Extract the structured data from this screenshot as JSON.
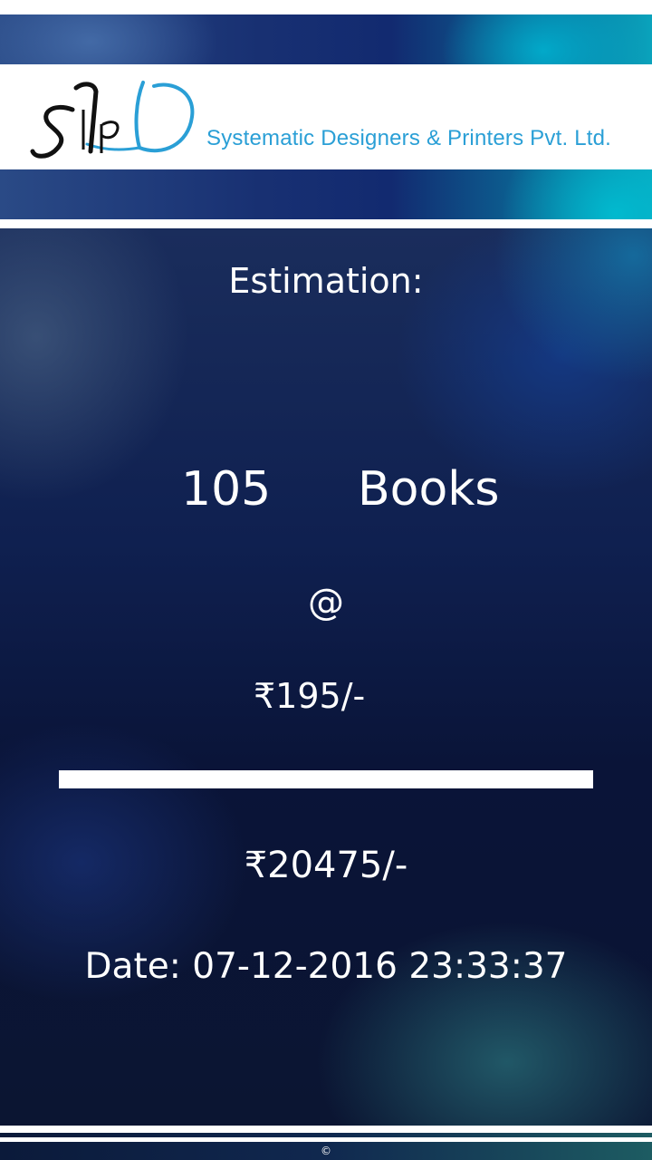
{
  "header": {
    "logo_text": "SPL",
    "company_name": "Systematic Designers & Printers Pvt. Ltd.",
    "brand_color": "#2a9fd6"
  },
  "estimation": {
    "heading": "Estimation:",
    "quantity": "105",
    "unit": "Books",
    "at_symbol": "@",
    "rate": "₹195/-",
    "total": "₹20475/-",
    "date": "Date: 07-12-2016 23:33:37"
  },
  "footer": {
    "copyright": "©"
  }
}
